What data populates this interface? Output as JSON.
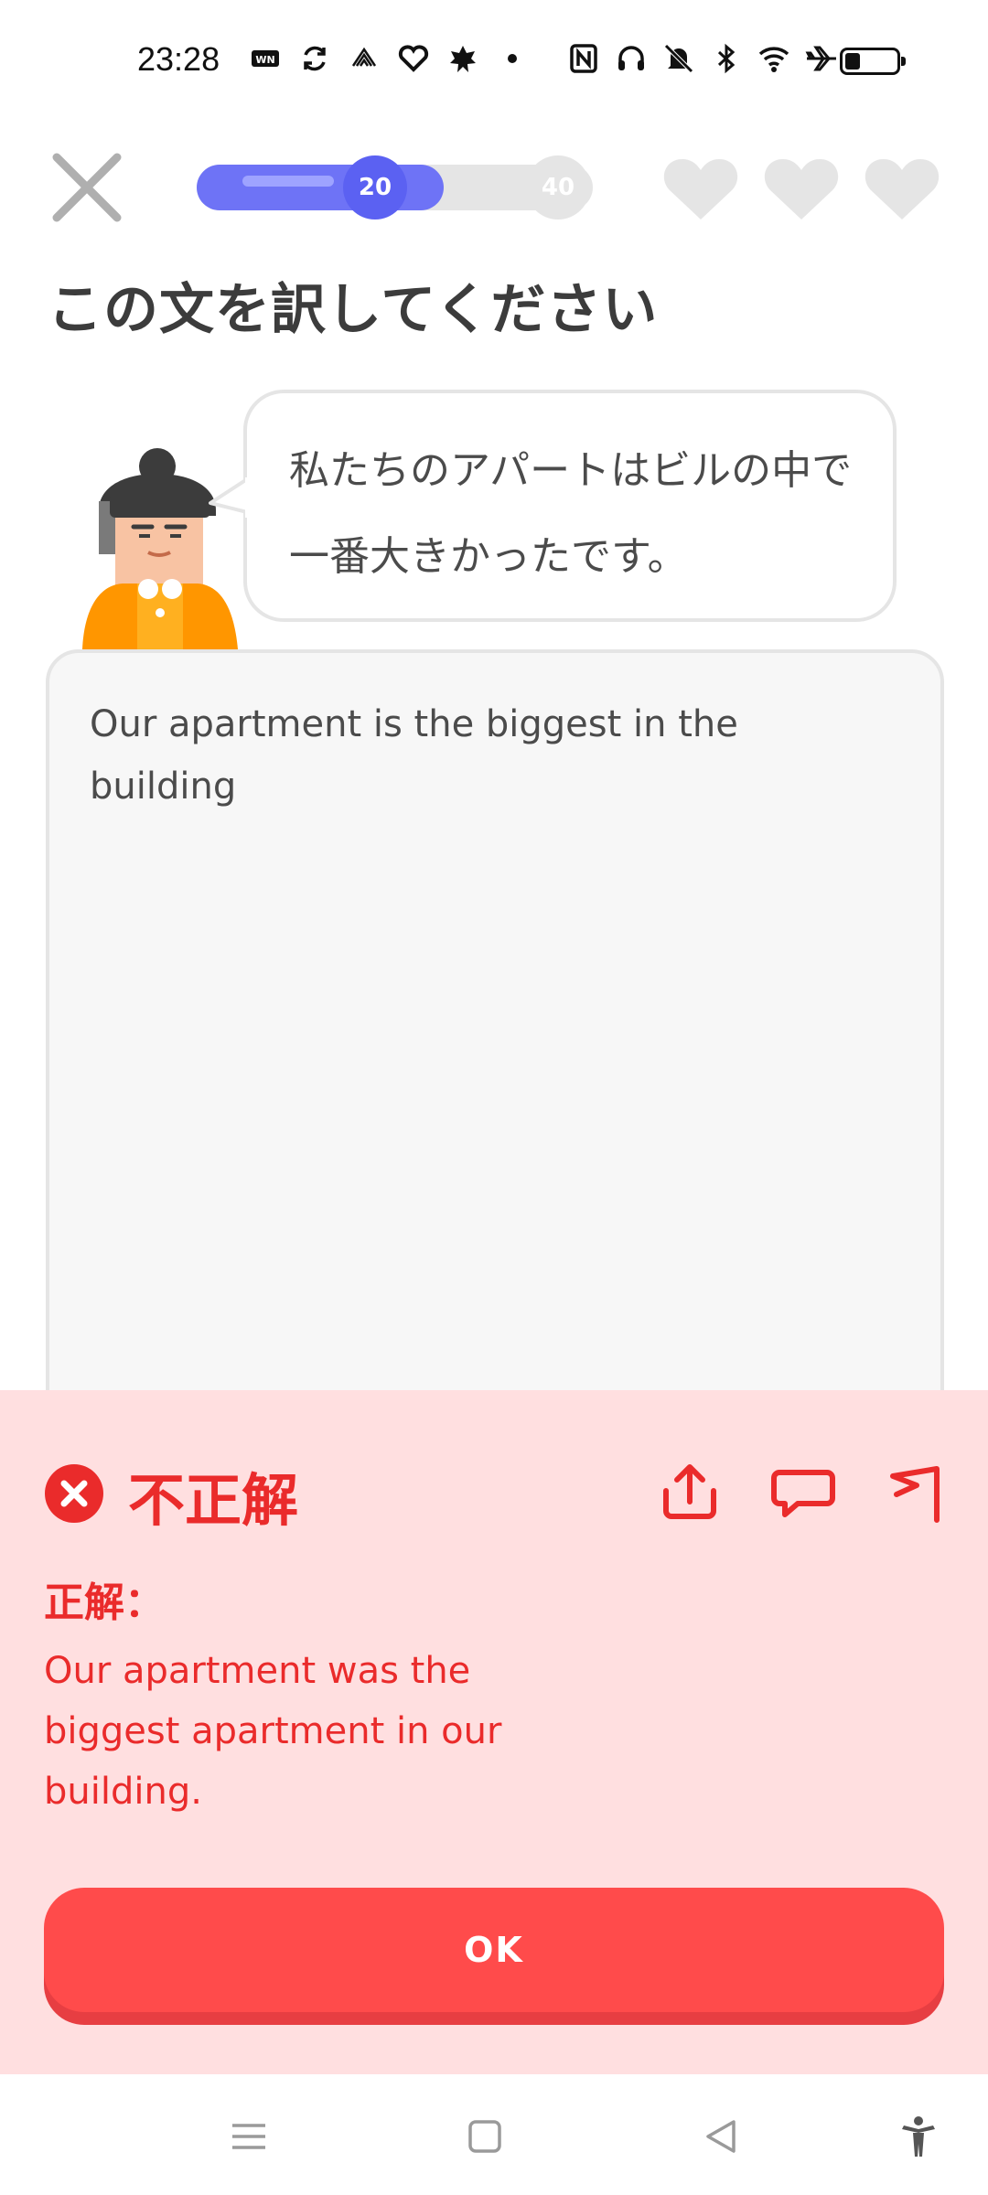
{
  "status_bar": {
    "time": "23:28",
    "left_icons": [
      "wn-app-icon",
      "sync-icon",
      "signal-app-icon",
      "heart-app-icon",
      "leaf-app-icon",
      "dot-icon"
    ],
    "right_icons": [
      "nfc-icon",
      "headphones-icon",
      "mute-icon",
      "bluetooth-icon",
      "wifi-icon",
      "airplane-icon",
      "battery-icon"
    ],
    "battery_level": 0.3
  },
  "header": {
    "progress": 0.65,
    "milestones": [
      "20",
      "40"
    ],
    "hearts": 3
  },
  "prompt": {
    "title": "この文を訳してください",
    "sentence": "私たちのアパートはビルの中で一番大きかったです。"
  },
  "answer": {
    "text": "Our apartment is the biggest in the building"
  },
  "feedback": {
    "status": "不正解",
    "correct_label": "正解：",
    "correct_answer": "Our apartment was the biggest apartment in our building.",
    "ok_label": "OK",
    "colors": {
      "background": "#ffdfe0",
      "text": "#ea2b2b",
      "button": "#ff4b4b"
    }
  },
  "colors": {
    "progress": "#6e73f6",
    "heart_empty": "#e5e5e5"
  }
}
